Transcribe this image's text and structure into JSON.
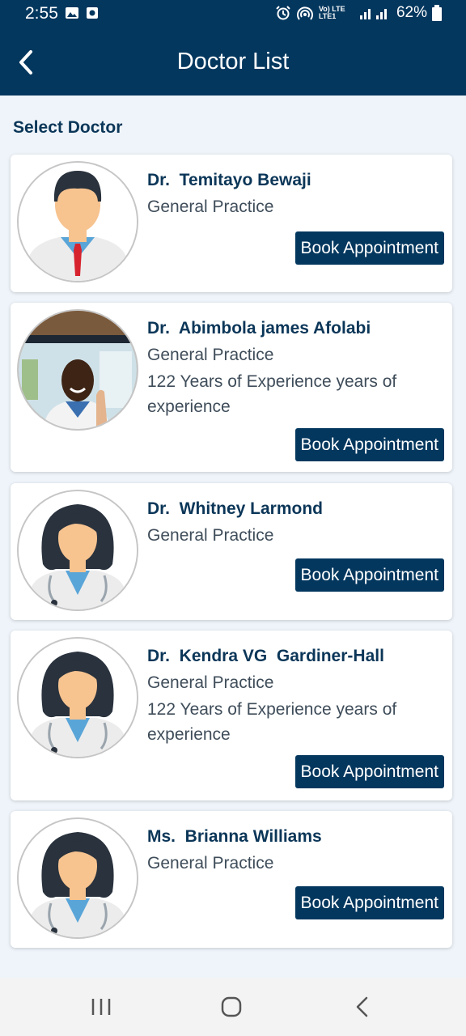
{
  "status_bar": {
    "time": "2:55",
    "battery": "62%",
    "network": "Vo) LTE LTE1"
  },
  "app_bar": {
    "title": "Doctor List",
    "back_icon": "chevron-left-icon"
  },
  "section_title": "Select Doctor",
  "doctors": [
    {
      "name": "Dr.  Temitayo Bewaji",
      "specialty": "General Practice",
      "experience": "",
      "avatar": "male-doctor-avatar",
      "button": "Book Appointment"
    },
    {
      "name": "Dr.  Abimbola james Afolabi",
      "specialty": "General Practice",
      "experience": "122 Years of Experience years of experience",
      "avatar": "doctor-photo",
      "button": "Book Appointment"
    },
    {
      "name": "Dr.  Whitney Larmond",
      "specialty": "General Practice",
      "experience": "",
      "avatar": "female-doctor-avatar",
      "button": "Book Appointment"
    },
    {
      "name": "Dr.  Kendra VG  Gardiner-Hall",
      "specialty": "General Practice",
      "experience": "122 Years of Experience years of experience",
      "avatar": "female-doctor-avatar",
      "button": "Book Appointment"
    },
    {
      "name": "Ms.  Brianna Williams",
      "specialty": "General Practice",
      "experience": "",
      "avatar": "female-doctor-avatar",
      "button": "Book Appointment"
    }
  ],
  "colors": {
    "primary": "#04375e",
    "background": "#eef4fa",
    "name_text": "#0b3658",
    "body_text": "#3f4d5a"
  },
  "nav_bar": {
    "recents_icon": "recents-icon",
    "home_icon": "home-icon",
    "back_icon": "back-icon"
  }
}
